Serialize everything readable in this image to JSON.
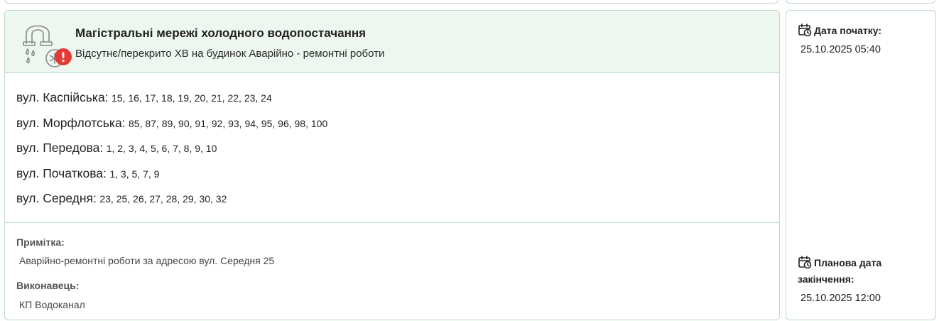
{
  "header": {
    "icon": "cold-water-pipe-icon",
    "alert_icon": "exclamation-alert-icon",
    "title": "Магістральні мережі холодного водопостачання",
    "subtitle": "Відсутнє/перекрито ХВ на будинок Аварійно - ремонтні роботи"
  },
  "streets": [
    {
      "name": "вул. Каспійська:",
      "houses": "15, 16, 17, 18, 19, 20, 21, 22, 23, 24"
    },
    {
      "name": "вул. Морфлотська:",
      "houses": "85, 87, 89, 90, 91, 92, 93, 94, 95, 96, 98, 100"
    },
    {
      "name": "вул. Передова:",
      "houses": "1, 2, 3, 4, 5, 6, 7, 8, 9, 10"
    },
    {
      "name": "вул. Початкова:",
      "houses": "1, 3, 5, 7, 9"
    },
    {
      "name": "вул. Середня:",
      "houses": "23, 25, 26, 27, 28, 29, 30, 32"
    }
  ],
  "footer": {
    "note_label": "Примітка:",
    "note_value": "Аварійно-ремонтні роботи за адресою вул. Середня 25",
    "executor_label": "Виконавець:",
    "executor_value": "КП Водоканал"
  },
  "dates": {
    "start_label": "Дата початку:",
    "start_value": "25.10.2025 05:40",
    "end_label_line1": "Планова дата",
    "end_label_line2": "закінчення:",
    "end_value": "25.10.2025 12:00",
    "icon": "calendar-clock-icon"
  },
  "colors": {
    "border": "#bcd9c6",
    "header_bg": "#eef6f0",
    "alert": "#e53935"
  }
}
